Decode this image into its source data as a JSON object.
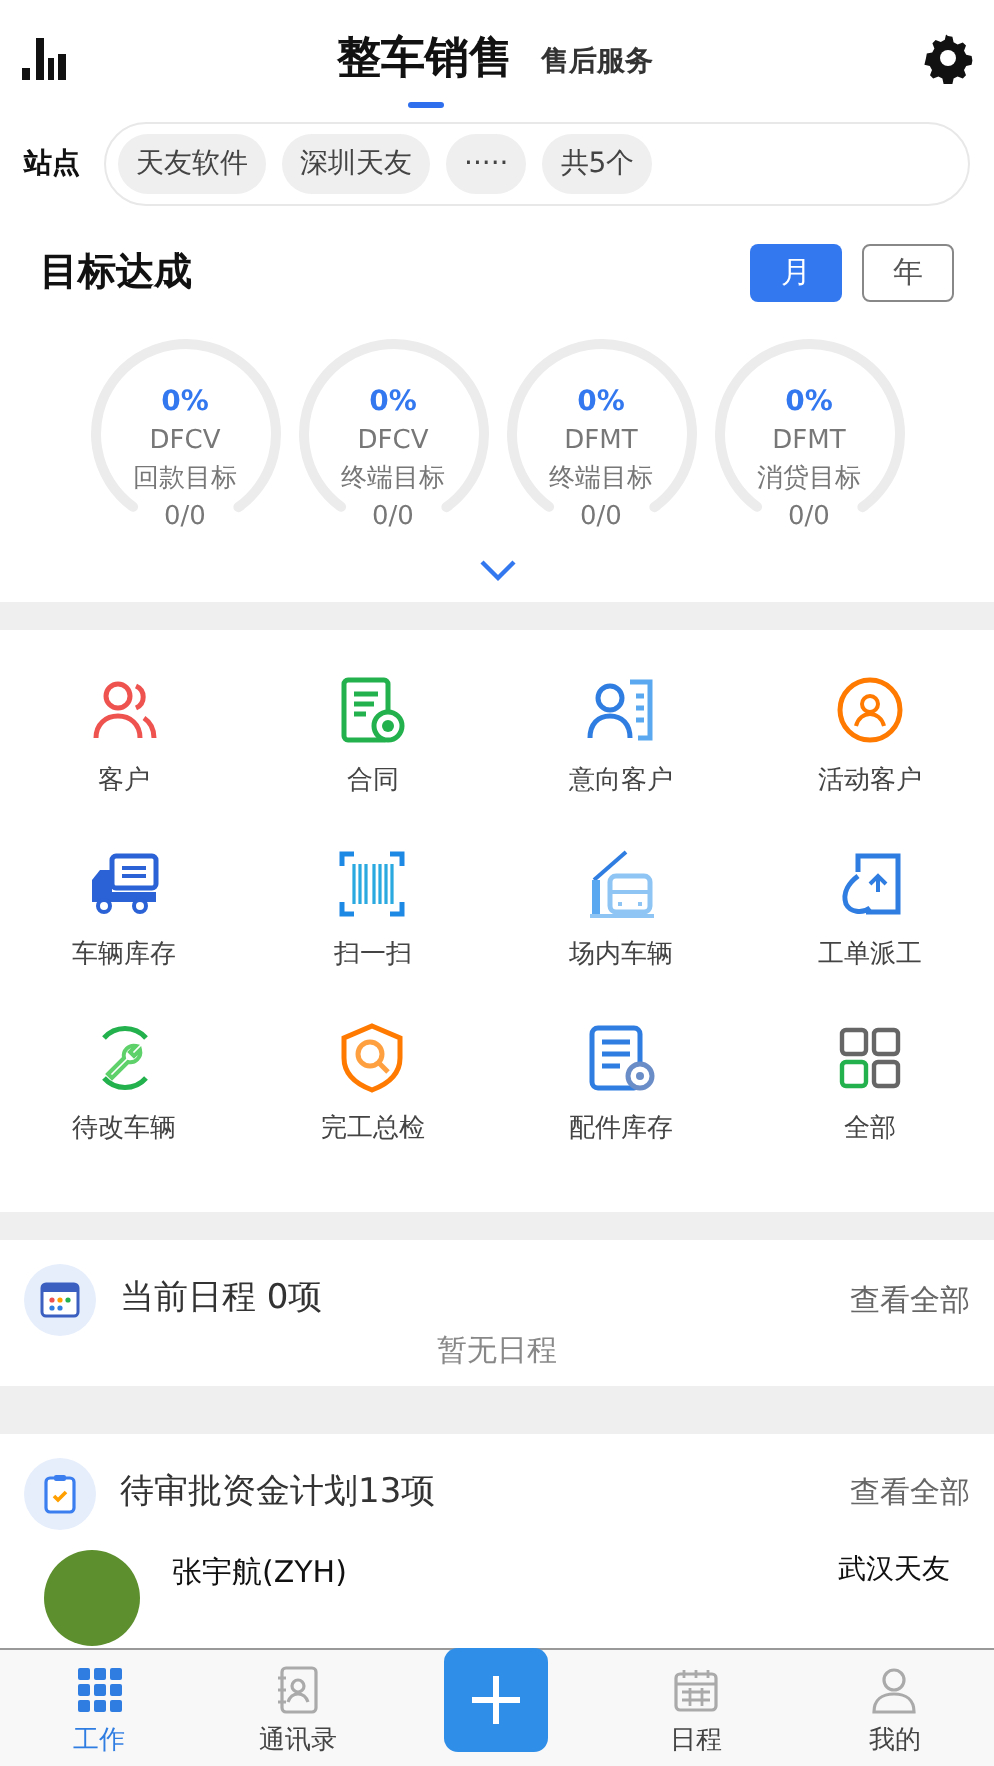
{
  "header": {
    "tabs": [
      {
        "label": "整车销售",
        "selected": true
      },
      {
        "label": "售后服务",
        "selected": false
      }
    ]
  },
  "sites": {
    "label": "站点",
    "chips": [
      "天友软件",
      "深圳天友",
      "·····",
      "共5个"
    ]
  },
  "targets": {
    "title": "目标达成",
    "periods": [
      {
        "label": "月",
        "selected": true
      },
      {
        "label": "年",
        "selected": false
      }
    ],
    "gauges": [
      {
        "percent": "0%",
        "brand": "DFCV",
        "name": "回款目标",
        "ratio": "0/0",
        "level": 0
      },
      {
        "percent": "0%",
        "brand": "DFCV",
        "name": "终端目标",
        "ratio": "0/0",
        "level": 0
      },
      {
        "percent": "0%",
        "brand": "DFMT",
        "name": "终端目标",
        "ratio": "0/0",
        "level": 0
      },
      {
        "percent": "0%",
        "brand": "DFMT",
        "name": "消贷目标",
        "ratio": "0/0",
        "level": 0
      }
    ]
  },
  "shortcuts": [
    {
      "label": "客户",
      "kind": "people"
    },
    {
      "label": "合同",
      "kind": "contract"
    },
    {
      "label": "意向客户",
      "kind": "card"
    },
    {
      "label": "活动客户",
      "kind": "badge"
    },
    {
      "label": "车辆库存",
      "kind": "truck"
    },
    {
      "label": "扫一扫",
      "kind": "scan"
    },
    {
      "label": "场内车辆",
      "kind": "gate"
    },
    {
      "label": "工单派工",
      "kind": "upload"
    },
    {
      "label": "待改车辆",
      "kind": "wrench"
    },
    {
      "label": "完工总检",
      "kind": "shield"
    },
    {
      "label": "配件库存",
      "kind": "doc"
    },
    {
      "label": "全部",
      "kind": "grid"
    }
  ],
  "schedule": {
    "title": "当前日程 0项",
    "link": "查看全部",
    "empty": "暂无日程"
  },
  "approvals": {
    "title": "待审批资金计划13项",
    "link": "查看全部",
    "rows": [
      {
        "name": "张宇航(ZYH)",
        "site": "武汉天友"
      }
    ]
  },
  "tabbar": [
    {
      "label": "工作",
      "kind": "work",
      "selected": true
    },
    {
      "label": "通讯录",
      "kind": "contacts",
      "selected": false
    },
    {
      "kind": "add"
    },
    {
      "label": "日程",
      "kind": "calendar",
      "selected": false
    },
    {
      "label": "我的",
      "kind": "me",
      "selected": false
    }
  ]
}
